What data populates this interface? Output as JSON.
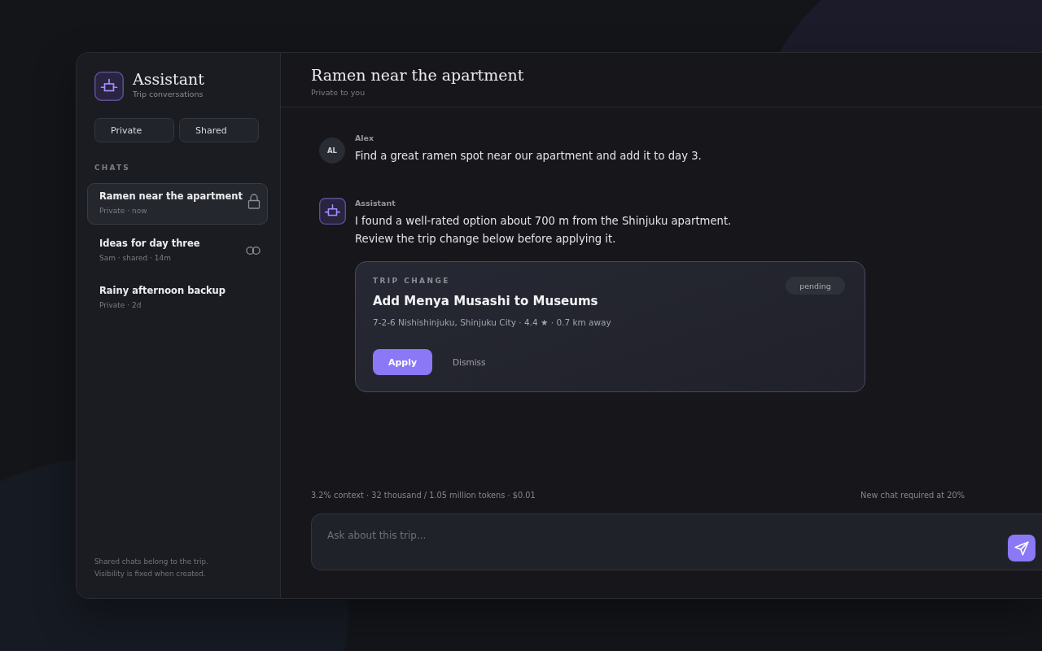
{
  "sidebar": {
    "title": "Assistant",
    "subtitle": "Trip conversations",
    "new_chat_buttons": [
      "Private",
      "Shared"
    ],
    "section_label": "CHATS",
    "chats": [
      {
        "title": "Ramen near the apartment",
        "meta": "Private · now",
        "selected": true,
        "kind": "locked"
      },
      {
        "title": "Ideas for day three",
        "meta": "Sam · shared · 14m",
        "selected": false,
        "kind": "shared"
      },
      {
        "title": "Rainy afternoon backup",
        "meta": "Private · 2d",
        "selected": false,
        "kind": "plain"
      }
    ],
    "footer": [
      "Shared chats belong to the trip.",
      "Visibility is fixed when created."
    ]
  },
  "header": {
    "title": "Ramen near the apartment",
    "subtitle": "Private to you"
  },
  "messages": [
    {
      "kind": "user",
      "author": "Alex",
      "initials": "AL",
      "lines": [
        "Find a great ramen spot near our apartment and add it to day 3."
      ]
    },
    {
      "kind": "assistant",
      "author": "Assistant",
      "lines": [
        "I found a well-rated option about 700 m from the Shinjuku apartment.",
        "Review the trip change below before applying it."
      ],
      "proposal": {
        "label": "TRIP CHANGE",
        "title": "Add Menya Musashi to Museums",
        "details": "7-2-6 Nishishinjuku, Shinjuku City · 4.4 ★ · 0.7 km away",
        "status": "pending",
        "actions": [
          {
            "kind": "primary",
            "label": "Apply"
          },
          {
            "kind": "secondary",
            "label": "Dismiss"
          }
        ]
      }
    }
  ],
  "usage": {
    "summary": "3.2% context · 32 thousand / 1.05 million tokens · $0.01",
    "limit_note": "New chat required at 20%"
  },
  "composer": {
    "placeholder": "Ask about this trip..."
  }
}
